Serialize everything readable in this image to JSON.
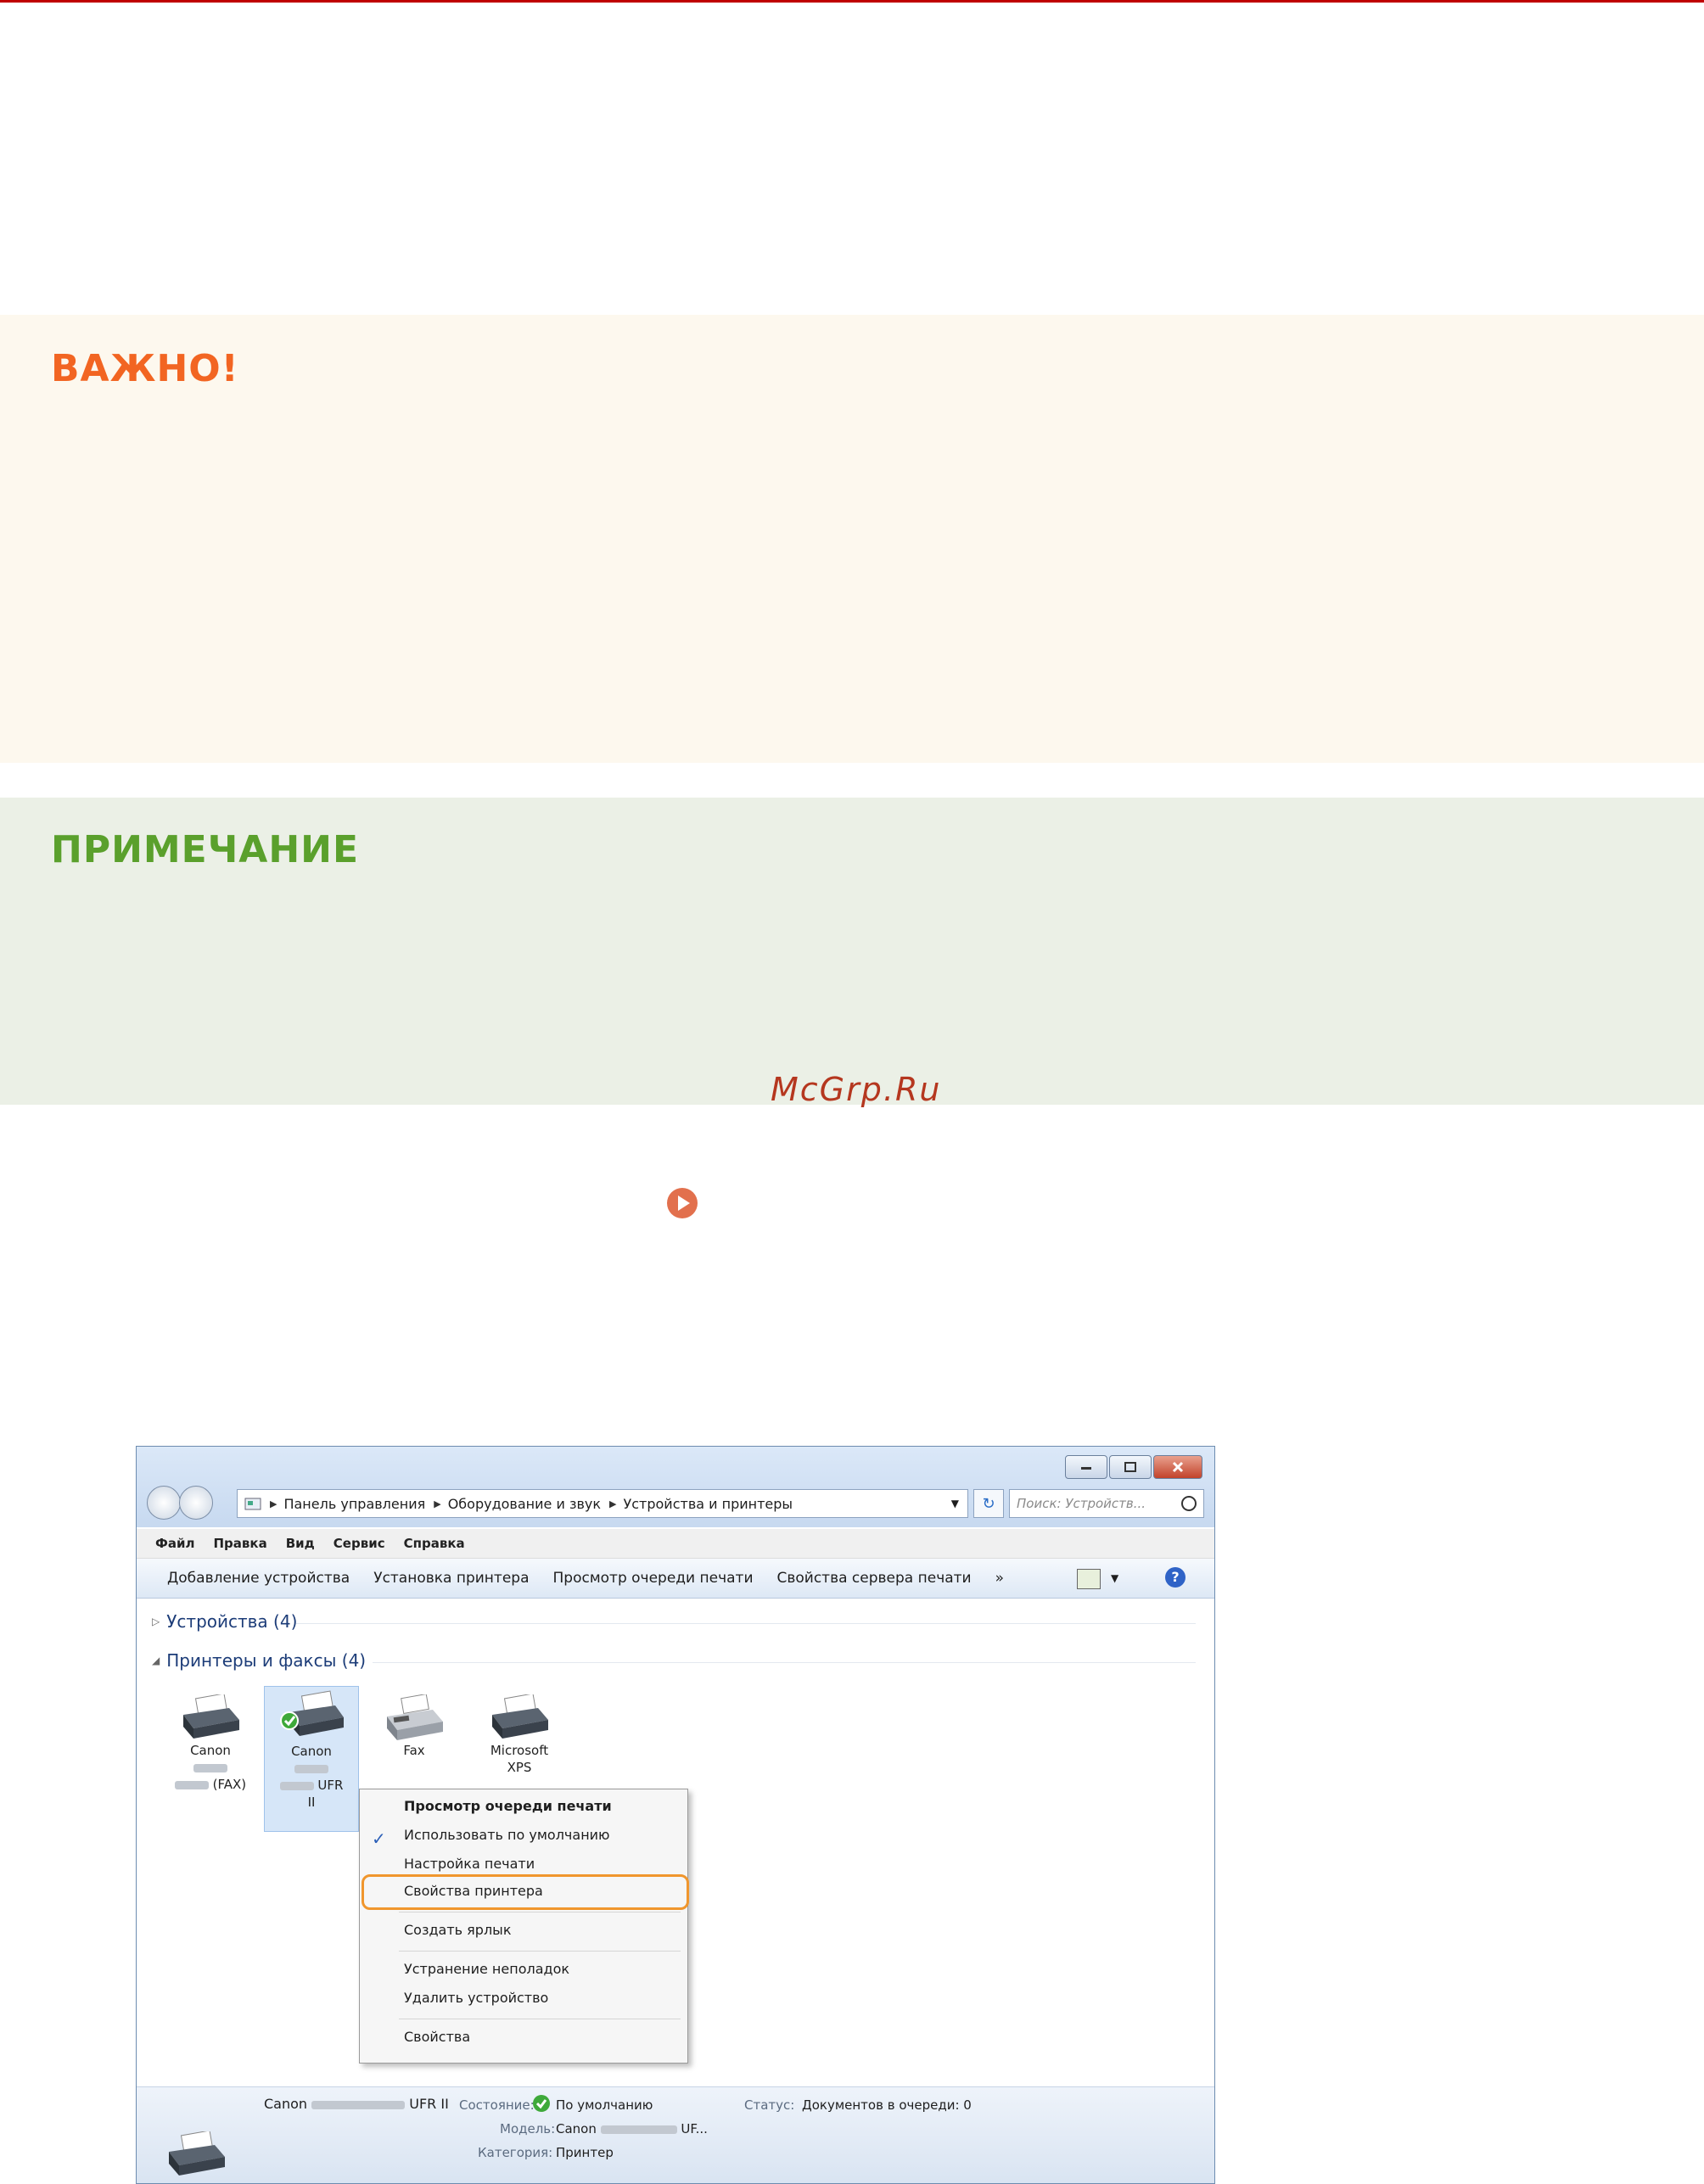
{
  "important": {
    "title": "ВАЖНО!"
  },
  "note": {
    "title": "ПРИМЕЧАНИЕ"
  },
  "watermark": "McGrp.Ru",
  "window": {
    "address": [
      "Панель управления",
      "Оборудование и звук",
      "Устройства и принтеры"
    ],
    "search_placeholder": "Поиск: Устройств...",
    "menu": [
      "Файл",
      "Правка",
      "Вид",
      "Сервис",
      "Справка"
    ],
    "toolbar": [
      "Добавление устройства",
      "Установка принтера",
      "Просмотр очереди печати",
      "Свойства сервера печати",
      "»"
    ],
    "sections": {
      "devices": "Устройства (4)",
      "printers": "Принтеры и факсы (4)"
    },
    "devices": [
      {
        "line1": "Canon",
        "line3": "(FAX)"
      },
      {
        "line1": "Canon",
        "line3": "UFR",
        "line4": "II"
      },
      {
        "line1": "Fax"
      },
      {
        "line1": "Microsoft",
        "line2": "XPS"
      }
    ],
    "context_menu": [
      "Просмотр очереди печати",
      "Использовать по умолчанию",
      "Настройка печати",
      "Свойства принтера",
      "Создать ярлык",
      "Устранение неполадок",
      "Удалить устройство",
      "Свойства"
    ],
    "details": {
      "name_prefix": "Canon",
      "name_suffix": "UFR II",
      "state_label": "Состояние:",
      "state_value": "По умолчанию",
      "status_label": "Статус:",
      "status_value": "Документов в очереди: 0",
      "model_label": "Модель:",
      "model_prefix": "Canon",
      "model_suffix": "UF...",
      "category_label": "Категория:",
      "category_value": "Принтер"
    }
  },
  "colors": {
    "important": "#f26522",
    "note": "#5aa02c",
    "highlight": "#f0962d"
  }
}
